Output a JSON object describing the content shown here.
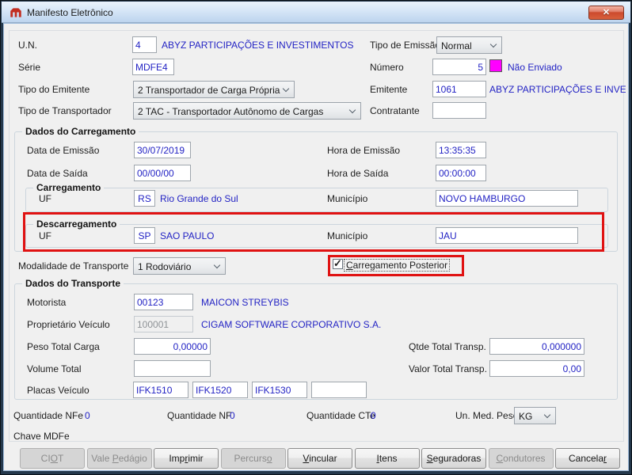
{
  "window": {
    "title": "Manifesto Eletrônico"
  },
  "icons": {
    "close": "✕",
    "check": "✓"
  },
  "colors": {
    "value_text": "#2323C4",
    "status_nao_enviado": "#FF00FF",
    "annotation": "#E01212"
  },
  "fields": {
    "un": {
      "label": "U.N.",
      "value": "4",
      "description": "ABYZ PARTICIPAÇÕES E INVESTIMENTOS"
    },
    "tipo_emissao": {
      "label": "Tipo de Emissão",
      "value": "Normal"
    },
    "serie": {
      "label": "Série",
      "value": "MDFE4"
    },
    "numero": {
      "label": "Número",
      "value": "5",
      "status": "Não Enviado"
    },
    "tipo_emitente": {
      "label": "Tipo do Emitente",
      "value": "2 Transportador de Carga Própria"
    },
    "emitente": {
      "label": "Emitente",
      "value": "1061",
      "description": "ABYZ PARTICIPAÇÕES E INVESTIMENTOS"
    },
    "tipo_transportador": {
      "label": "Tipo de Transportador",
      "value": "2 TAC - Transportador Autônomo de Cargas"
    },
    "contratante": {
      "label": "Contratante",
      "value": ""
    }
  },
  "dados_carregamento": {
    "title": "Dados do Carregamento",
    "data_emissao": {
      "label": "Data de Emissão",
      "value": "30/07/2019"
    },
    "hora_emissao": {
      "label": "Hora de Emissão",
      "value": "13:35:35"
    },
    "data_saida": {
      "label": "Data de Saída",
      "value": "00/00/00"
    },
    "hora_saida": {
      "label": "Hora de Saída",
      "value": "00:00:00"
    },
    "carregamento": {
      "title": "Carregamento",
      "uf_label": "UF",
      "uf": "RS",
      "uf_descricao": "Rio Grande do Sul",
      "municipio_label": "Município",
      "municipio": "NOVO HAMBURGO"
    },
    "descarregamento": {
      "title": "Descarregamento",
      "uf_label": "UF",
      "uf": "SP",
      "uf_descricao": "SAO PAULO",
      "municipio_label": "Município",
      "municipio": "JAU"
    }
  },
  "modalidade": {
    "label": "Modalidade de Transporte",
    "value": "1 Rodoviário"
  },
  "carregamento_posterior": {
    "label": "Carregamento Posterior",
    "checked": true,
    "mnemonic_index": 0
  },
  "dados_transporte": {
    "title": "Dados do Transporte",
    "motorista": {
      "label": "Motorista",
      "value": "00123",
      "descricao": "MAICON STREYBIS"
    },
    "proprietario_veiculo": {
      "label": "Proprietário Veículo",
      "value": "100001",
      "descricao": "CIGAM SOFTWARE CORPORATIVO S.A."
    },
    "peso_total_carga": {
      "label": "Peso Total Carga",
      "value": "0,00000"
    },
    "qtde_total_transp": {
      "label": "Qtde Total Transp.",
      "value": "0,000000"
    },
    "volume_total": {
      "label": "Volume Total",
      "value": ""
    },
    "valor_total_transp": {
      "label": "Valor Total Transp.",
      "value": "0,00"
    },
    "placas_veiculo": {
      "label": "Placas Veículo",
      "values": [
        "IFK1510",
        "IFK1520",
        "IFK1530",
        ""
      ]
    }
  },
  "rodape": {
    "quantidade_nfe": {
      "label": "Quantidade NFe",
      "value": "0"
    },
    "quantidade_nf": {
      "label": "Quantidade NF",
      "value": "0"
    },
    "quantidade_cte": {
      "label": "Quantidade CTe",
      "value": "0"
    },
    "un_med_peso": {
      "label": "Un. Med. Peso",
      "value": "KG"
    },
    "chave_mdfe": {
      "label": "Chave MDFe",
      "value": ""
    }
  },
  "buttons": [
    {
      "label": "CIOT",
      "mnemonic_index": 2,
      "enabled": false
    },
    {
      "label": "Vale Pedágio",
      "mnemonic_index": 5,
      "enabled": false
    },
    {
      "label": "Imprimir",
      "mnemonic_index": 3,
      "enabled": true
    },
    {
      "label": "Percurso",
      "mnemonic_index": 7,
      "enabled": false
    },
    {
      "label": "Vincular",
      "mnemonic_index": 0,
      "enabled": true
    },
    {
      "label": "Itens",
      "mnemonic_index": 0,
      "enabled": true
    },
    {
      "label": "Seguradoras",
      "mnemonic_index": 0,
      "enabled": true
    },
    {
      "label": "Condutores",
      "mnemonic_index": 0,
      "enabled": false
    },
    {
      "label": "Cancelar",
      "mnemonic_index": 7,
      "enabled": true
    }
  ]
}
